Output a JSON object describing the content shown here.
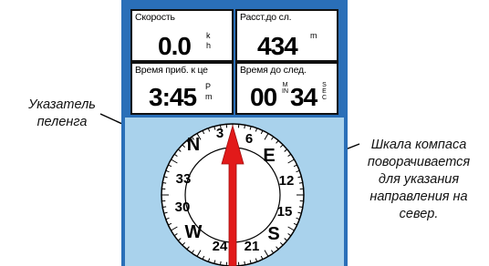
{
  "captions": {
    "left": [
      "Указатель",
      "пеленга"
    ],
    "right": [
      "Шкала компаса",
      "поворачивается",
      "для указания",
      "направления на",
      "север."
    ]
  },
  "fields": [
    {
      "label": "Скорость",
      "value": "0.0",
      "unit_top": "k",
      "unit_bottom": "h"
    },
    {
      "label": "Расст.до сл.",
      "value": "434",
      "unit_top": "m"
    },
    {
      "label": "Время приб. к це",
      "value": "3:45",
      "unit_top": "P",
      "unit_bottom": "m"
    },
    {
      "label": "Время до след.",
      "value_min": "00",
      "min_unit": "MIN",
      "value_sec": "34",
      "sec_unit": "SEC"
    }
  ],
  "compass": {
    "labels": [
      "N",
      "3",
      "6",
      "E",
      "12",
      "15",
      "S",
      "21",
      "24",
      "W",
      "30",
      "33"
    ],
    "icons": {
      "pointer": "bearing-pointer-arrow-icon"
    },
    "colors": {
      "pointer": "#e21a1a",
      "background": "#a9d2ec",
      "bezel": "#2a6fb8"
    }
  }
}
